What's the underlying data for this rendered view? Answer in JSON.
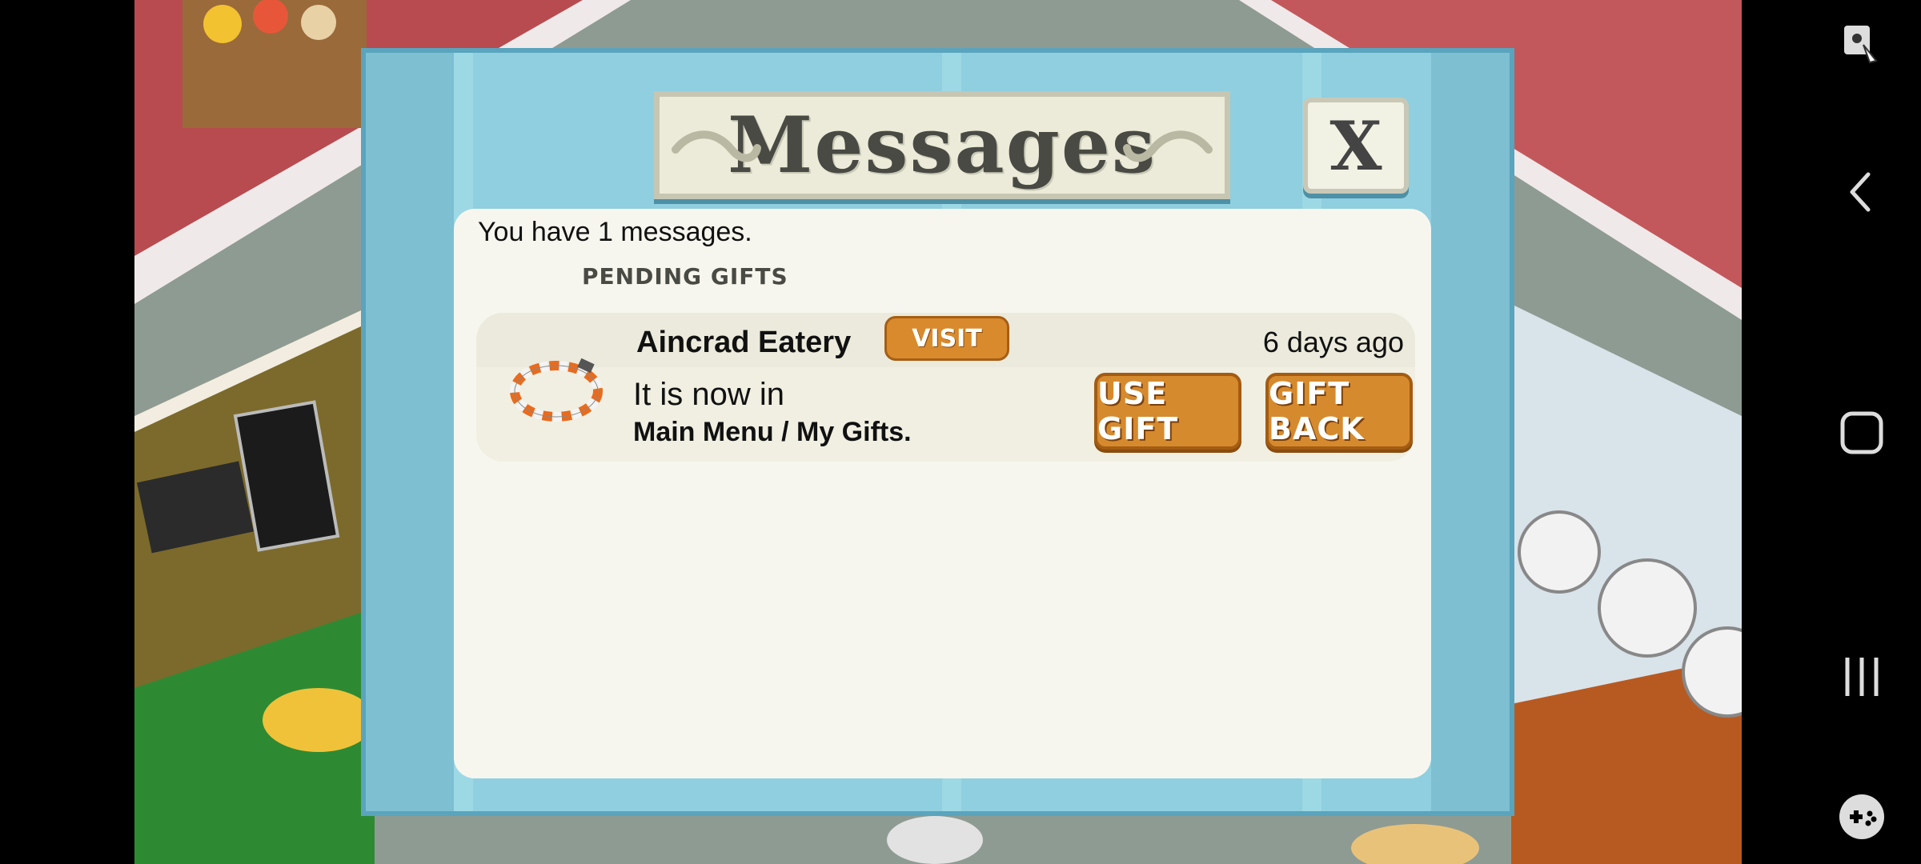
{
  "dialog": {
    "title": "Messages",
    "close_label": "X",
    "message_count_text": "You have 1 messages.",
    "section_label": "PENDING GIFTS",
    "gifts": [
      {
        "sender": "Aincrad Eatery",
        "visit_label": "VISIT",
        "time_ago": "6 days ago",
        "line1": "It is now in",
        "line2": "Main Menu / My Gifts.",
        "use_label": "USE GIFT",
        "gift_back_label": "GIFT BACK",
        "item_icon": "bracelet-icon"
      }
    ]
  },
  "navbar": {
    "icons": [
      "screenshot-lock-icon",
      "back-icon",
      "home-icon",
      "recents-icon",
      "game-launcher-icon"
    ]
  },
  "colors": {
    "dialog_frame": "#7fbfd2",
    "button_orange": "#d68a2e",
    "panel_bg": "#f7f6ee"
  }
}
